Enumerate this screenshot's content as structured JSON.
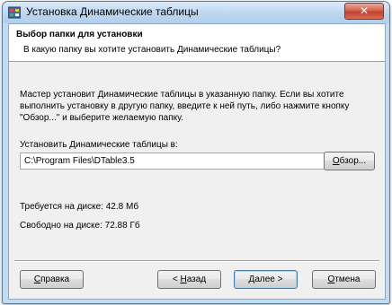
{
  "window": {
    "title": "Установка Динамические таблицы",
    "close_label": "✕"
  },
  "header": {
    "title": "Выбор папки для установки",
    "subtitle": "В какую папку вы хотите установить Динамические таблицы?"
  },
  "body": {
    "description": "Мастер установит Динамические таблицы в указанную папку. Если вы хотите выполнить установку в другую папку, введите к ней путь, либо нажмите кнопку \"Обзор...\" и выберите желаемую папку.",
    "install_label": "Установить Динамические таблицы в:",
    "install_path": "C:\\Program Files\\DTable3.5",
    "browse": {
      "accel": "О",
      "rest": "бзор..."
    },
    "required_label": "Требуется на диске:",
    "required_value": "42.8 Мб",
    "free_label": "Свободно на диске:",
    "free_value": "72.88 Гб"
  },
  "footer": {
    "help": {
      "accel": "С",
      "rest": "правка"
    },
    "back": {
      "prefix": "< ",
      "accel": "Н",
      "rest": "азад"
    },
    "next": {
      "accel": "Д",
      "rest": "алее >"
    },
    "cancel": {
      "accel": "О",
      "rest": "тмена"
    }
  },
  "colors": {
    "title_bar": "#c2dcf3",
    "close_button": "#c9503a",
    "dialog_background": "#f0f0f0",
    "default_button_border": "#3c7fb1"
  },
  "icons": {
    "app": "installer-app-icon",
    "close": "close-icon"
  }
}
